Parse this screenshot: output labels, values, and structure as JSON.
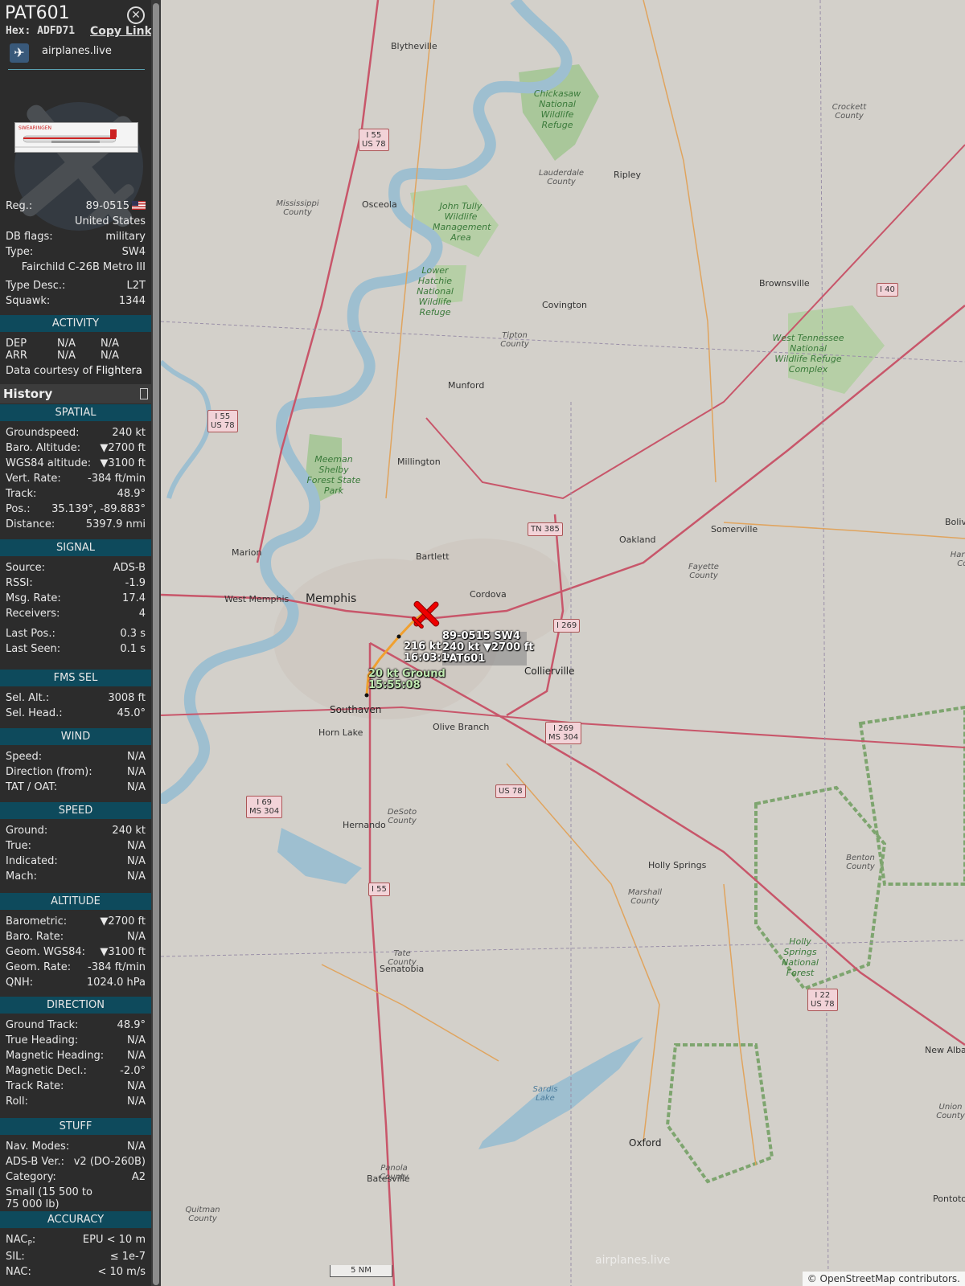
{
  "sidebar": {
    "callsign": "PAT601",
    "hex_label": "Hex:",
    "hex": "ADFD71",
    "copy_link": "Copy Link",
    "source_site": "airplanes.live",
    "reg_label": "Reg.:",
    "reg": "89-0515",
    "country": "United States",
    "db_flags_label": "DB flags:",
    "db_flags": "military",
    "type_label": "Type:",
    "type": "SW4",
    "type_full": "Fairchild C-26B Metro III",
    "type_desc_label": "Type Desc.:",
    "type_desc": "L2T",
    "squawk_label": "Squawk:",
    "squawk": "1344",
    "activity_header": "ACTIVITY",
    "dep_label": "DEP",
    "dep_a": "N/A",
    "dep_b": "N/A",
    "arr_label": "ARR",
    "arr_a": "N/A",
    "arr_b": "N/A",
    "courtesy_prefix": "Data courtesy of",
    "courtesy_name": "Flightera",
    "history": "History",
    "spatial": {
      "header": "SPATIAL",
      "rows": [
        {
          "label": "Groundspeed:",
          "value": "240 kt"
        },
        {
          "label": "Baro. Altitude:",
          "value": "▼2700 ft"
        },
        {
          "label": "WGS84 altitude:",
          "value": "▼3100 ft"
        },
        {
          "label": "Vert. Rate:",
          "value": "-384 ft/min"
        },
        {
          "label": "Track:",
          "value": "48.9°"
        },
        {
          "label": "Pos.:",
          "value": "35.139°, -89.883°"
        },
        {
          "label": "Distance:",
          "value": "5397.9 nmi"
        }
      ]
    },
    "signal": {
      "header": "SIGNAL",
      "rows": [
        {
          "label": "Source:",
          "value": "ADS-B"
        },
        {
          "label": "RSSI:",
          "value": "-1.9"
        },
        {
          "label": "Msg. Rate:",
          "value": "17.4"
        },
        {
          "label": "Receivers:",
          "value": "4"
        },
        {
          "label": "Last Pos.:",
          "value": "0.3 s"
        },
        {
          "label": "Last Seen:",
          "value": "0.1 s"
        }
      ]
    },
    "fms": {
      "header": "FMS SEL",
      "rows": [
        {
          "label": "Sel. Alt.:",
          "value": "3008 ft"
        },
        {
          "label": "Sel. Head.:",
          "value": "45.0°"
        }
      ]
    },
    "wind": {
      "header": "WIND",
      "rows": [
        {
          "label": "Speed:",
          "value": "N/A"
        },
        {
          "label": "Direction (from):",
          "value": "N/A"
        },
        {
          "label": "TAT / OAT:",
          "value": "N/A"
        }
      ]
    },
    "speed": {
      "header": "SPEED",
      "rows": [
        {
          "label": "Ground:",
          "value": "240 kt"
        },
        {
          "label": "True:",
          "value": "N/A"
        },
        {
          "label": "Indicated:",
          "value": "N/A"
        },
        {
          "label": "Mach:",
          "value": "N/A"
        }
      ]
    },
    "altitude": {
      "header": "ALTITUDE",
      "rows": [
        {
          "label": "Barometric:",
          "value": "▼2700 ft"
        },
        {
          "label": "Baro. Rate:",
          "value": "N/A"
        },
        {
          "label": "Geom. WGS84:",
          "value": "▼3100 ft"
        },
        {
          "label": "Geom. Rate:",
          "value": "-384 ft/min"
        },
        {
          "label": "QNH:",
          "value": "1024.0 hPa"
        }
      ]
    },
    "direction": {
      "header": "DIRECTION",
      "rows": [
        {
          "label": "Ground Track:",
          "value": "48.9°"
        },
        {
          "label": "True Heading:",
          "value": "N/A"
        },
        {
          "label": "Magnetic Heading:",
          "value": "N/A"
        },
        {
          "label": "Magnetic Decl.:",
          "value": "-2.0°"
        },
        {
          "label": "Track Rate:",
          "value": "N/A"
        },
        {
          "label": "Roll:",
          "value": "N/A"
        }
      ]
    },
    "stuff": {
      "header": "STUFF",
      "rows": [
        {
          "label": "Nav. Modes:",
          "value": "N/A"
        },
        {
          "label": "ADS-B Ver.:",
          "value": "v2 (DO-260B)"
        },
        {
          "label": "Category:",
          "value": "A2"
        }
      ],
      "category_desc_1": "Small (15 500 to",
      "category_desc_2": "75 000 lb)"
    },
    "accuracy": {
      "header": "ACCURACY",
      "nacp_label": "NAC",
      "nacp_sub": "P",
      "nacp_value": "EPU < 10 m",
      "sil_label": "SIL:",
      "sil_value": "≤ 1e-7",
      "nacv_label": "NAC",
      "nacv_value": "< 10 m/s"
    }
  },
  "map": {
    "aircraft": {
      "label_line1": "89-0515 SW4",
      "label_line2": "240 kt ▼2700 ft",
      "label_line3": "PAT601",
      "track_label_speed": "216 kt",
      "track_label_time": "16:03:1",
      "ground_label_speed": "20 kt  Ground",
      "ground_label_time": "15:55:08"
    },
    "cities": [
      {
        "name": "Memphis",
        "cls": "big"
      },
      {
        "name": "West Memphis",
        "cls": ""
      },
      {
        "name": "Marion",
        "cls": ""
      },
      {
        "name": "Bartlett",
        "cls": ""
      },
      {
        "name": "Cordova",
        "cls": ""
      },
      {
        "name": "Collierville",
        "cls": "med"
      },
      {
        "name": "Southaven",
        "cls": "med"
      },
      {
        "name": "Horn Lake",
        "cls": ""
      },
      {
        "name": "Olive Branch",
        "cls": ""
      },
      {
        "name": "Hernando",
        "cls": ""
      },
      {
        "name": "Senatobia",
        "cls": ""
      },
      {
        "name": "Batesville",
        "cls": ""
      },
      {
        "name": "Oxford",
        "cls": "med"
      },
      {
        "name": "Holly Springs",
        "cls": ""
      },
      {
        "name": "Millington",
        "cls": ""
      },
      {
        "name": "Munford",
        "cls": ""
      },
      {
        "name": "Covington",
        "cls": ""
      },
      {
        "name": "Brownsville",
        "cls": ""
      },
      {
        "name": "Somerville",
        "cls": ""
      },
      {
        "name": "Oakland",
        "cls": ""
      },
      {
        "name": "Ripley",
        "cls": ""
      },
      {
        "name": "Osceola",
        "cls": ""
      },
      {
        "name": "Blytheville",
        "cls": ""
      },
      {
        "name": "Bolivar",
        "cls": ""
      },
      {
        "name": "New Albany",
        "cls": ""
      },
      {
        "name": "Pontotoc",
        "cls": ""
      }
    ],
    "counties": [
      "Mississippi County",
      "Lauderdale County",
      "Crockett County",
      "Tipton County",
      "Fayette County",
      "Hardeman County",
      "DeSoto County",
      "Marshall County",
      "Benton County",
      "Tate County",
      "Panola County",
      "Quitman County",
      "Union County"
    ],
    "parks": [
      "Chickasaw National Wildlife Refuge",
      "John Tully Wildlife Management Area",
      "Lower Hatchie National Wildlife Refuge",
      "West Tennessee National Wildlife Refuge Complex",
      "Meeman Shelby Forest State Park",
      "Holly Springs National Forest"
    ],
    "water": [
      "Sardis Lake"
    ],
    "shields": [
      {
        "text": "I 55\nUS 78"
      },
      {
        "text": "I 55\nUS 78"
      },
      {
        "text": "TN 385"
      },
      {
        "text": "I 269"
      },
      {
        "text": "I 269\nMS 304"
      },
      {
        "text": "US 78"
      },
      {
        "text": "I 69\nMS 304"
      },
      {
        "text": "I 55"
      },
      {
        "text": "I 40"
      },
      {
        "text": "I 22\nUS 78"
      }
    ],
    "scale": "5 NM",
    "attribution": "© OpenStreetMap contributors.",
    "watermark": "airplanes.live"
  }
}
